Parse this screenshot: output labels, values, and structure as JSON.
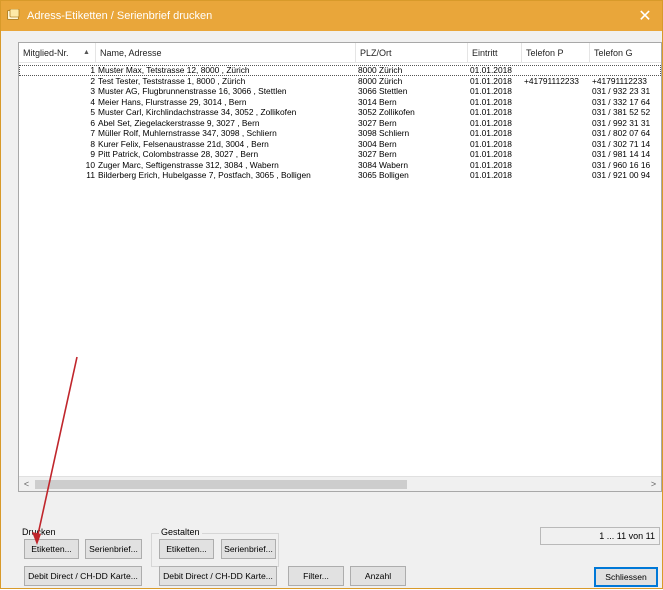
{
  "window": {
    "title": "Adress-Etiketten / Serienbrief drucken",
    "close_glyph": "✕"
  },
  "list": {
    "columns": [
      "Mitglied-Nr.",
      "Name, Adresse",
      "PLZ/Ort",
      "Eintritt",
      "Telefon P",
      "Telefon G"
    ],
    "sort_glyph": "▲",
    "rows": [
      {
        "nr": "1",
        "name": "Muster Max, Tetstrasse 12, 8000 , Zürich",
        "plz": "8000 Zürich",
        "eintritt": "01.01.2018",
        "telp": "",
        "telg": ""
      },
      {
        "nr": "2",
        "name": "Test Tester, Teststrasse 1, 8000 , Zürich",
        "plz": "8000 Zürich",
        "eintritt": "01.01.2018",
        "telp": "+41791112233",
        "telg": "+41791112233"
      },
      {
        "nr": "3",
        "name": "Muster AG, Flugbrunnenstrasse 16, 3066 , Stettlen",
        "plz": "3066 Stettlen",
        "eintritt": "01.01.2018",
        "telp": "",
        "telg": "031 / 932 23 31"
      },
      {
        "nr": "4",
        "name": "Meier Hans, Flurstrasse 29, 3014 , Bern",
        "plz": "3014 Bern",
        "eintritt": "01.01.2018",
        "telp": "",
        "telg": "031 / 332 17 64"
      },
      {
        "nr": "5",
        "name": "Muster Carl, Kirchlindachstrasse 34, 3052 , Zollikofen",
        "plz": "3052 Zollikofen",
        "eintritt": "01.01.2018",
        "telp": "",
        "telg": "031 / 381 52 52"
      },
      {
        "nr": "6",
        "name": "Abel Set, Ziegelackerstrasse 9, 3027 , Bern",
        "plz": "3027 Bern",
        "eintritt": "01.01.2018",
        "telp": "",
        "telg": "031 / 992 31 31"
      },
      {
        "nr": "7",
        "name": "Müller Rolf, Muhlernstrasse 347, 3098 , Schliern",
        "plz": "3098 Schliern",
        "eintritt": "01.01.2018",
        "telp": "",
        "telg": "031 / 802 07 64"
      },
      {
        "nr": "8",
        "name": "Kurer Felix, Felsenaustrasse 21d, 3004 , Bern",
        "plz": "3004 Bern",
        "eintritt": "01.01.2018",
        "telp": "",
        "telg": "031 / 302 71 14"
      },
      {
        "nr": "9",
        "name": "Pitt Patrick, Colombstrasse 28, 3027 , Bern",
        "plz": "3027 Bern",
        "eintritt": "01.01.2018",
        "telp": "",
        "telg": "031 / 981 14 14"
      },
      {
        "nr": "10",
        "name": "Zuger Marc, Seftigenstrasse 312, 3084 , Wabern",
        "plz": "3084 Wabern",
        "eintritt": "01.01.2018",
        "telp": "",
        "telg": "031 / 960 16 16"
      },
      {
        "nr": "11",
        "name": "Bilderberg Erich, Hubelgasse 7, Postfach, 3065 , Bolligen",
        "plz": "3065 Bolligen",
        "eintritt": "01.01.2018",
        "telp": "",
        "telg": "031 / 921 00 94"
      }
    ],
    "scroll_left_glyph": "<",
    "scroll_right_glyph": ">"
  },
  "drucken": {
    "label": "Drucken",
    "etiketten": "Etiketten...",
    "serienbrief": "Serienbrief...",
    "debit": "Debit Direct / CH-DD Karte..."
  },
  "gestalten": {
    "label": "Gestalten",
    "etiketten": "Etiketten...",
    "serienbrief": "Serienbrief...",
    "debit": "Debit Direct / CH-DD Karte..."
  },
  "filter_label": "Filter...",
  "anzahl_label": "Anzahl",
  "counter_text": "1 ... 11 von 11",
  "schliessen_label": "Schliessen",
  "colors": {
    "titlebar": "#e9a63a",
    "annotation_arrow": "#c0262c",
    "primary_border": "#0078d7"
  }
}
